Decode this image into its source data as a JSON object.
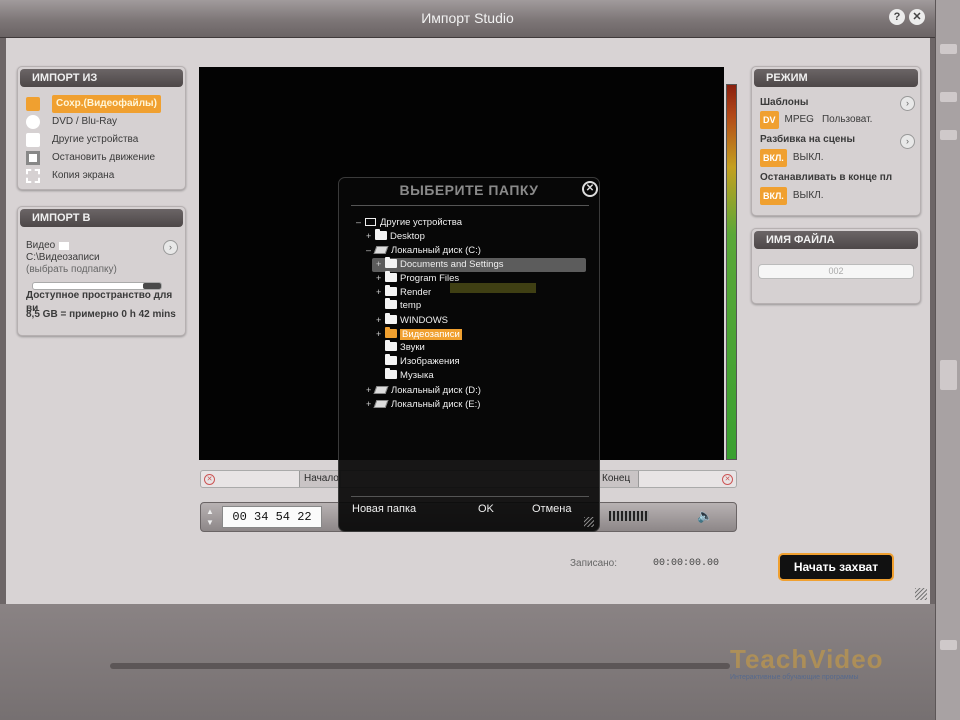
{
  "window": {
    "title": "Импорт Studio",
    "help_label": "?",
    "close_label": "✕"
  },
  "import_from": {
    "header": "ИМПОРТ ИЗ",
    "items": [
      {
        "label": "Сохр.(Видеофайлы)",
        "icon": "camcorder-icon",
        "selected": true
      },
      {
        "label": "DVD / Blu-Ray",
        "icon": "disc-icon"
      },
      {
        "label": "Другие устройства",
        "icon": "devices-icon"
      },
      {
        "label": "Остановить движение",
        "icon": "stop-motion-icon"
      },
      {
        "label": "Копия экрана",
        "icon": "screen-capture-icon"
      }
    ]
  },
  "import_to": {
    "header": "ИМПОРТ В",
    "video_label": "Видео",
    "path": "C:\\Видеозаписи",
    "subfolder_hint": "(выбрать подпапку)",
    "space_label": "Доступное пространство для ви",
    "space_value": "8,5 GB = примерно 0 h 42 mins",
    "space_fraction": 0.92
  },
  "mode": {
    "header": "РЕЖИМ",
    "templates_label": "Шаблоны",
    "template_tag": "DV",
    "template_values": [
      "MPEG",
      "Пользоват."
    ],
    "scene_split_label": "Разбивка на сцены",
    "scene_split_on": "ВКЛ.",
    "scene_split_off": "ВЫКЛ.",
    "stop_end_label": "Останавливать в конце пл",
    "stop_end_on": "ВКЛ.",
    "stop_end_off": "ВЫКЛ."
  },
  "filename": {
    "header": "ИМЯ ФАЙЛА",
    "value": "002"
  },
  "range": {
    "start_label": "Начало",
    "end_label": "Конец"
  },
  "transport": {
    "timecode": "00 34 54 22"
  },
  "dialog": {
    "title": "ВЫБЕРИТЕ ПАПКУ",
    "close_label": "✕",
    "tree": [
      {
        "label": "Другие устройства",
        "depth": 0,
        "expander": "–",
        "icon": "monitor"
      },
      {
        "label": "Desktop",
        "depth": 1,
        "expander": "+",
        "icon": "folder"
      },
      {
        "label": "Локальный диск (C:)",
        "depth": 1,
        "expander": "–",
        "icon": "drive"
      },
      {
        "label": "Documents and Settings",
        "depth": 2,
        "expander": "+",
        "icon": "folder",
        "selected": true
      },
      {
        "label": "Program Files",
        "depth": 2,
        "expander": "+",
        "icon": "folder"
      },
      {
        "label": "Render",
        "depth": 2,
        "expander": "+",
        "icon": "folder"
      },
      {
        "label": "temp",
        "depth": 2,
        "expander": "",
        "icon": "folder"
      },
      {
        "label": "WINDOWS",
        "depth": 2,
        "expander": "+",
        "icon": "folder"
      },
      {
        "label": "Видеозаписи",
        "depth": 2,
        "expander": "+",
        "icon": "folder",
        "highlight": true
      },
      {
        "label": "Звуки",
        "depth": 2,
        "expander": "",
        "icon": "folder"
      },
      {
        "label": "Изображения",
        "depth": 2,
        "expander": "",
        "icon": "folder"
      },
      {
        "label": "Музыка",
        "depth": 2,
        "expander": "",
        "icon": "folder"
      },
      {
        "label": "Локальный диск (D:)",
        "depth": 1,
        "expander": "+",
        "icon": "drive"
      },
      {
        "label": "Локальный диск (E:)",
        "depth": 1,
        "expander": "+",
        "icon": "drive"
      }
    ],
    "new_folder_label": "Новая папка",
    "ok_label": "OK",
    "cancel_label": "Отмена"
  },
  "recorded": {
    "label": "Записано:",
    "value": "00:00:00.00"
  },
  "start_capture_label": "Начать захват",
  "watermark": {
    "brand": "TeachVideo",
    "tagline": "Интерактивные обучающие программы"
  },
  "colors": {
    "accent": "#f0a030",
    "panel_head": "#4d4748",
    "window_bg": "#d8d3d4"
  }
}
